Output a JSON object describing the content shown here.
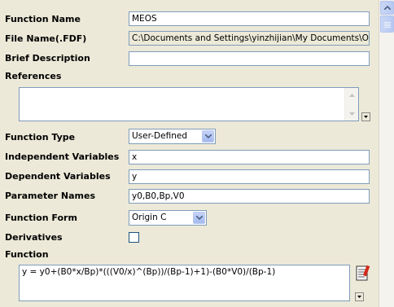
{
  "form": {
    "function_name": {
      "label": "Function Name",
      "value": "MEOS"
    },
    "file_name": {
      "label": "File Name(.FDF)",
      "value": "C:\\Documents and Settings\\yinzhijian\\My Documents\\OriginL"
    },
    "brief_description": {
      "label": "Brief Description",
      "value": ""
    },
    "references": {
      "label": "References",
      "value": ""
    },
    "function_type": {
      "label": "Function Type",
      "value": "User-Defined"
    },
    "independent_variables": {
      "label": "Independent Variables",
      "value": "x"
    },
    "dependent_variables": {
      "label": "Dependent Variables",
      "value": "y"
    },
    "parameter_names": {
      "label": "Parameter Names",
      "value": "y0,B0,Bp,V0"
    },
    "function_form": {
      "label": "Function Form",
      "value": "Origin C"
    },
    "derivatives": {
      "label": "Derivatives",
      "checked": false
    },
    "function": {
      "label": "Function",
      "value": "y = y0+(B0*x/Bp)*(((V0/x)^(Bp))/(Bp-1)+1)-(B0*V0)/(Bp-1)"
    }
  },
  "icons": {
    "combo_arrow": "chevron-down-icon",
    "scroll_up": "scroll-up-arrow-icon",
    "scroll_down": "scroll-down-arrow-icon",
    "function_editor": "code-editor-icon"
  }
}
